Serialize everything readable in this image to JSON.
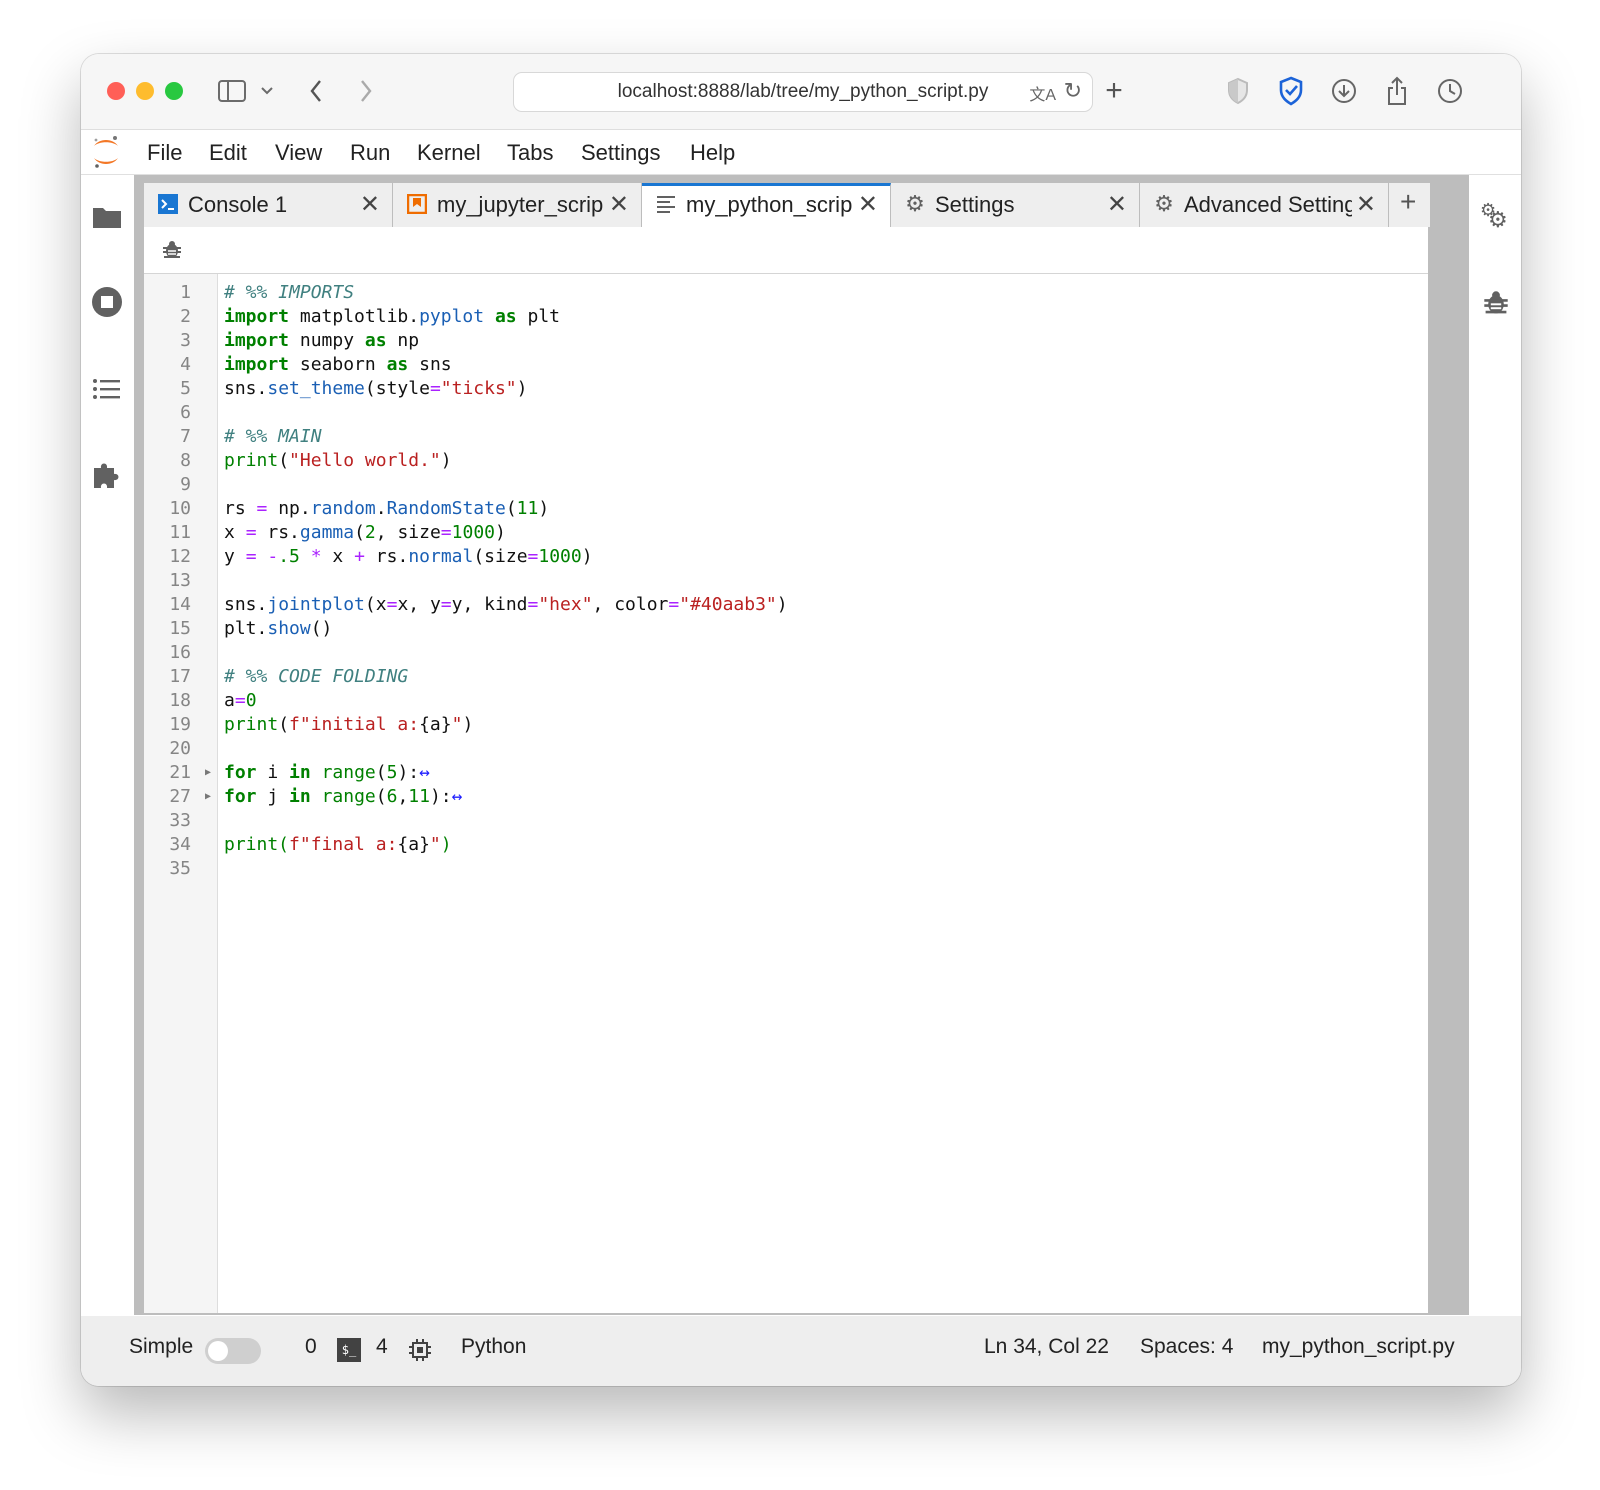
{
  "browser": {
    "url": "localhost:8888/lab/tree/my_python_script.py"
  },
  "menu": [
    "File",
    "Edit",
    "View",
    "Run",
    "Kernel",
    "Tabs",
    "Settings",
    "Help"
  ],
  "tabs": [
    {
      "label": "Console 1",
      "icon": "console-icon"
    },
    {
      "label": "my_jupyter_scrip",
      "icon": "notebook-icon"
    },
    {
      "label": "my_python_scrip",
      "icon": "text-file-icon",
      "active": true
    },
    {
      "label": "Settings",
      "icon": "gear-icon"
    },
    {
      "label": "Advanced Setting",
      "icon": "gear-icon"
    }
  ],
  "editor": {
    "lines": [
      {
        "n": "1",
        "tokens": [
          [
            "cm",
            "# %% IMPORTS"
          ]
        ]
      },
      {
        "n": "2",
        "tokens": [
          [
            "kw",
            "import"
          ],
          [
            "",
            " matplotlib."
          ],
          [
            "prop",
            "pyplot"
          ],
          [
            "",
            " "
          ],
          [
            "kw",
            "as"
          ],
          [
            "",
            " plt"
          ]
        ]
      },
      {
        "n": "3",
        "tokens": [
          [
            "kw",
            "import"
          ],
          [
            "",
            " numpy "
          ],
          [
            "kw",
            "as"
          ],
          [
            "",
            " np"
          ]
        ]
      },
      {
        "n": "4",
        "tokens": [
          [
            "kw",
            "import"
          ],
          [
            "",
            " seaborn "
          ],
          [
            "kw",
            "as"
          ],
          [
            "",
            " sns"
          ]
        ]
      },
      {
        "n": "5",
        "tokens": [
          [
            "",
            "sns."
          ],
          [
            "prop",
            "set_theme"
          ],
          [
            "",
            "(style"
          ],
          [
            "op",
            "="
          ],
          [
            "str",
            "\"ticks\""
          ],
          [
            "",
            ")"
          ]
        ]
      },
      {
        "n": "6",
        "tokens": []
      },
      {
        "n": "7",
        "tokens": [
          [
            "cm",
            "# %% MAIN"
          ]
        ]
      },
      {
        "n": "8",
        "tokens": [
          [
            "num",
            "print"
          ],
          [
            "",
            "("
          ],
          [
            "str",
            "\"Hello world.\""
          ],
          [
            "",
            ")"
          ]
        ]
      },
      {
        "n": "9",
        "tokens": []
      },
      {
        "n": "10",
        "tokens": [
          [
            "",
            "rs "
          ],
          [
            "op",
            "="
          ],
          [
            "",
            " np."
          ],
          [
            "prop",
            "random"
          ],
          [
            "",
            "."
          ],
          [
            "prop",
            "RandomState"
          ],
          [
            "",
            "("
          ],
          [
            "num",
            "11"
          ],
          [
            "",
            ")"
          ]
        ]
      },
      {
        "n": "11",
        "tokens": [
          [
            "",
            "x "
          ],
          [
            "op",
            "="
          ],
          [
            "",
            " rs."
          ],
          [
            "prop",
            "gamma"
          ],
          [
            "",
            "("
          ],
          [
            "num",
            "2"
          ],
          [
            "",
            ", size"
          ],
          [
            "op",
            "="
          ],
          [
            "num",
            "1000"
          ],
          [
            "",
            ")"
          ]
        ]
      },
      {
        "n": "12",
        "tokens": [
          [
            "",
            "y "
          ],
          [
            "op",
            "="
          ],
          [
            "",
            " "
          ],
          [
            "op",
            "-"
          ],
          [
            "num",
            ".5"
          ],
          [
            "",
            " "
          ],
          [
            "op",
            "*"
          ],
          [
            "",
            " x "
          ],
          [
            "op",
            "+"
          ],
          [
            "",
            " rs."
          ],
          [
            "prop",
            "normal"
          ],
          [
            "",
            "(size"
          ],
          [
            "op",
            "="
          ],
          [
            "num",
            "1000"
          ],
          [
            "",
            ")"
          ]
        ]
      },
      {
        "n": "13",
        "tokens": []
      },
      {
        "n": "14",
        "tokens": [
          [
            "",
            "sns."
          ],
          [
            "prop",
            "jointplot"
          ],
          [
            "",
            "(x"
          ],
          [
            "op",
            "="
          ],
          [
            "",
            "x, y"
          ],
          [
            "op",
            "="
          ],
          [
            "",
            "y, kind"
          ],
          [
            "op",
            "="
          ],
          [
            "str",
            "\"hex\""
          ],
          [
            "",
            ", color"
          ],
          [
            "op",
            "="
          ],
          [
            "str",
            "\"#40aab3\""
          ],
          [
            "",
            ")"
          ]
        ]
      },
      {
        "n": "15",
        "tokens": [
          [
            "",
            "plt."
          ],
          [
            "prop",
            "show"
          ],
          [
            "",
            "()"
          ]
        ]
      },
      {
        "n": "16",
        "tokens": []
      },
      {
        "n": "17",
        "tokens": [
          [
            "cm",
            "# %% CODE FOLDING"
          ]
        ]
      },
      {
        "n": "18",
        "tokens": [
          [
            "",
            "a"
          ],
          [
            "op",
            "="
          ],
          [
            "num",
            "0"
          ]
        ]
      },
      {
        "n": "19",
        "tokens": [
          [
            "num",
            "print"
          ],
          [
            "",
            "("
          ],
          [
            "str",
            "f\"initial a:"
          ],
          [
            "",
            "{a}"
          ],
          [
            "str",
            "\""
          ],
          [
            "",
            ")"
          ]
        ]
      },
      {
        "n": "20",
        "tokens": []
      },
      {
        "n": "21",
        "fold": true,
        "tokens": [
          [
            "kw",
            "for"
          ],
          [
            "",
            " i "
          ],
          [
            "kw",
            "in"
          ],
          [
            "",
            " "
          ],
          [
            "num",
            "range"
          ],
          [
            "",
            "("
          ],
          [
            "num",
            "5"
          ],
          [
            "",
            "):"
          ],
          [
            "ell",
            "↔"
          ]
        ]
      },
      {
        "n": "27",
        "fold": true,
        "tokens": [
          [
            "kw",
            "for"
          ],
          [
            "",
            " j "
          ],
          [
            "kw",
            "in"
          ],
          [
            "",
            " "
          ],
          [
            "num",
            "range"
          ],
          [
            "",
            "("
          ],
          [
            "num",
            "6"
          ],
          [
            "",
            ","
          ],
          [
            "num",
            "11"
          ],
          [
            "",
            "):"
          ],
          [
            "ell",
            "↔"
          ]
        ]
      },
      {
        "n": "33",
        "tokens": []
      },
      {
        "n": "34",
        "tokens": [
          [
            "last",
            "print("
          ],
          [
            "str",
            "f\"final a:"
          ],
          [
            "",
            "{a}"
          ],
          [
            "str",
            "\""
          ],
          [
            "last",
            ")"
          ]
        ]
      },
      {
        "n": "35",
        "tokens": []
      }
    ]
  },
  "status": {
    "mode_label": "Simple",
    "mode_on": false,
    "terminals": "0",
    "kernels": "4",
    "kernel_name": "Python",
    "cursor": "Ln 34, Col 22",
    "spaces": "Spaces: 4",
    "filename": "my_python_script.py"
  },
  "colors": {
    "accent": "#1976d2",
    "close_red": "#ff5f57",
    "minimize_yellow": "#febc2e",
    "zoom_green": "#28c840",
    "jupyter_orange": "#f37726"
  }
}
